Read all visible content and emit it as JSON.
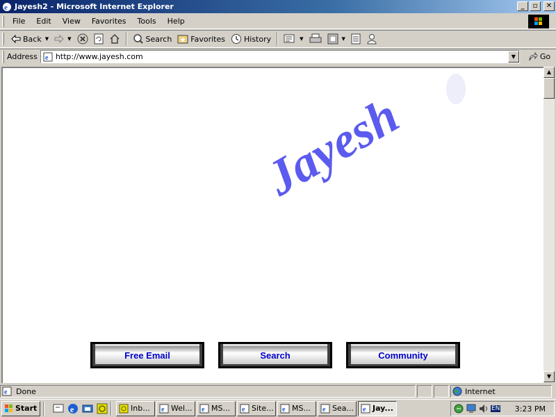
{
  "window": {
    "title": "Jayesh2 - Microsoft Internet Explorer"
  },
  "menu": [
    "File",
    "Edit",
    "View",
    "Favorites",
    "Tools",
    "Help"
  ],
  "toolbar": {
    "back": "Back",
    "search": "Search",
    "favorites": "Favorites",
    "history": "History"
  },
  "address": {
    "label": "Address",
    "url": "http://www.jayesh.com",
    "go": "Go"
  },
  "page": {
    "logo_text": "Jayesh",
    "buttons": [
      "Free Email",
      "Search",
      "Community"
    ],
    "logo_color": "#5b5bef"
  },
  "status": {
    "text": "Done",
    "zone": "Internet"
  },
  "taskbar": {
    "start": "Start",
    "tasks": [
      "Inb...",
      "Wel...",
      "MS...",
      "Site...",
      "MS...",
      "Sea...",
      "Jay..."
    ],
    "lang": "EN",
    "clock": "3:23 PM"
  }
}
